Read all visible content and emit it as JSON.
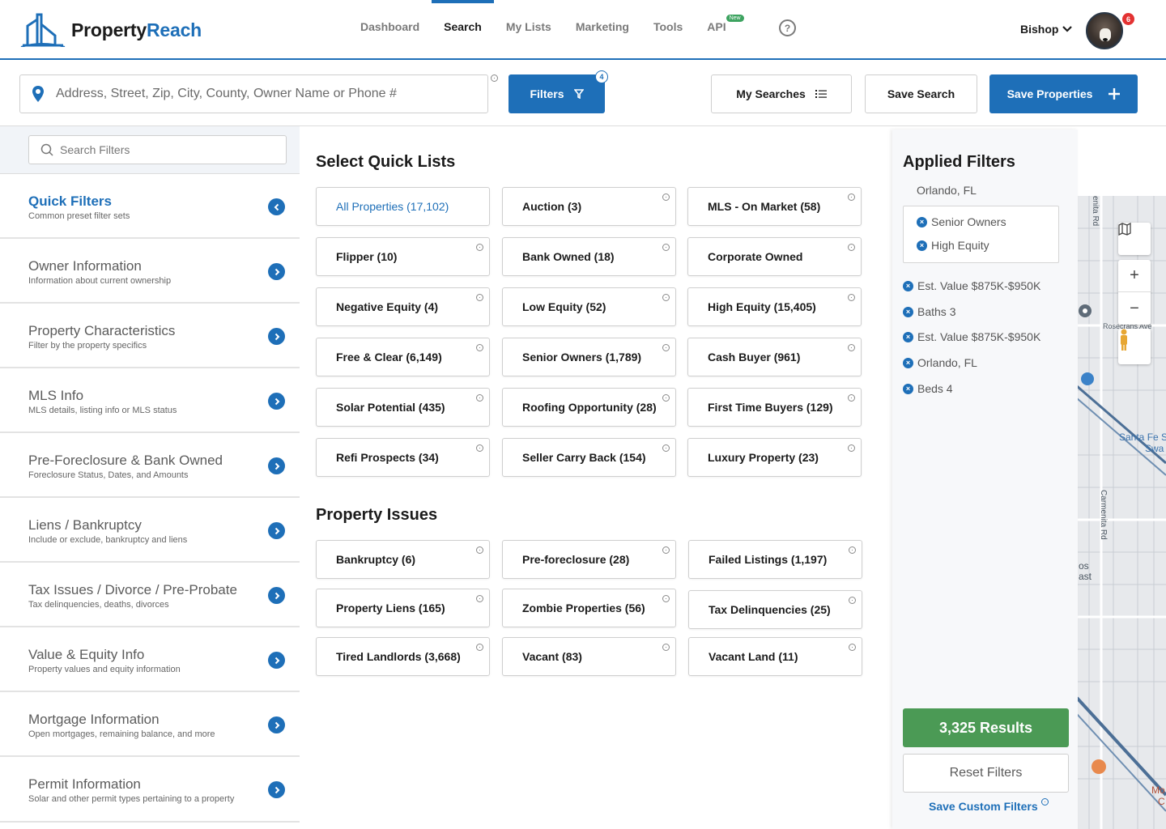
{
  "brand": {
    "name_part1": "Property",
    "name_part2": "Reach"
  },
  "nav": {
    "items": [
      {
        "label": "Dashboard"
      },
      {
        "label": "Search"
      },
      {
        "label": "My Lists"
      },
      {
        "label": "Marketing"
      },
      {
        "label": "Tools"
      },
      {
        "label": "API",
        "badge": "New"
      }
    ],
    "active": "Search",
    "help_icon": "question-circle-icon"
  },
  "user": {
    "name": "Bishop",
    "notification_count": "6"
  },
  "search": {
    "placeholder": "Address, Street, Zip, City, County, Owner Name or Phone #",
    "filters_label": "Filters",
    "filters_count": "4",
    "my_searches_label": "My Searches",
    "save_search_label": "Save Search",
    "save_properties_label": "Save Properties"
  },
  "sidebar": {
    "search_placeholder": "Search Filters",
    "items": [
      {
        "title": "Quick Filters",
        "desc": "Common preset filter sets"
      },
      {
        "title": "Owner Information",
        "desc": "Information about current ownership"
      },
      {
        "title": "Property Characteristics",
        "desc": "Filter by the property specifics"
      },
      {
        "title": "MLS Info",
        "desc": "MLS details, listing info or MLS status"
      },
      {
        "title": "Pre-Foreclosure & Bank Owned",
        "desc": "Foreclosure Status, Dates, and Amounts"
      },
      {
        "title": "Liens / Bankruptcy",
        "desc": "Include or exclude, bankruptcy and liens"
      },
      {
        "title": "Tax Issues / Divorce / Pre-Probate",
        "desc": "Tax delinquencies, deaths, divorces"
      },
      {
        "title": "Value & Equity Info",
        "desc": "Property values and equity information"
      },
      {
        "title": "Mortgage Information",
        "desc": "Open mortgages, remaining balance, and more"
      },
      {
        "title": "Permit Information",
        "desc": "Solar and other permit types pertaining to a property"
      }
    ]
  },
  "quick_lists": {
    "title": "Select Quick Lists",
    "items": [
      "All Properties (17,102)",
      "Auction (3)",
      "MLS - On Market (58)",
      "Flipper (10)",
      "Bank Owned (18)",
      "Corporate Owned",
      "Negative Equity (4)",
      "Low Equity (52)",
      "High Equity (15,405)",
      "Free & Clear (6,149)",
      "Senior Owners (1,789)",
      "Cash Buyer (961)",
      "Solar Potential (435)",
      "Roofing Opportunity (28)",
      "First Time Buyers (129)",
      "Refi Prospects (34)",
      "Seller Carry Back (154)",
      "Luxury Property (23)"
    ]
  },
  "property_issues": {
    "title": "Property Issues",
    "items": [
      "Bankruptcy (6)",
      "Pre-foreclosure (28)",
      "Failed Listings (1,197)",
      "Property Liens (165)",
      "Zombie Properties (56)",
      "Tax Delinquencies (25)",
      "Tired Landlords (3,668)",
      "Vacant (83)",
      "Vacant Land (11)"
    ]
  },
  "applied": {
    "title": "Applied Filters",
    "location": "Orlando, FL",
    "boxed_chips": [
      "Senior Owners",
      "High Equity"
    ],
    "chips": [
      "Est. Value $875K-$950K",
      "Baths 3",
      "Est. Value $875K-$950K",
      "Orlando, FL",
      "Beds 4"
    ],
    "results_label": "3,325 Results",
    "reset_label": "Reset Filters",
    "save_custom_label": "Save Custom Filters"
  },
  "map": {
    "labels": [
      "enita Rd",
      "Rosecrans Ave",
      "Santa Fe S",
      "Swa",
      "Carmenita Rd",
      "os",
      "ast",
      "Mo",
      "C"
    ]
  },
  "colors": {
    "accent": "#1e6fb8",
    "success": "#4b9a55",
    "badge_red": "#e33232"
  }
}
